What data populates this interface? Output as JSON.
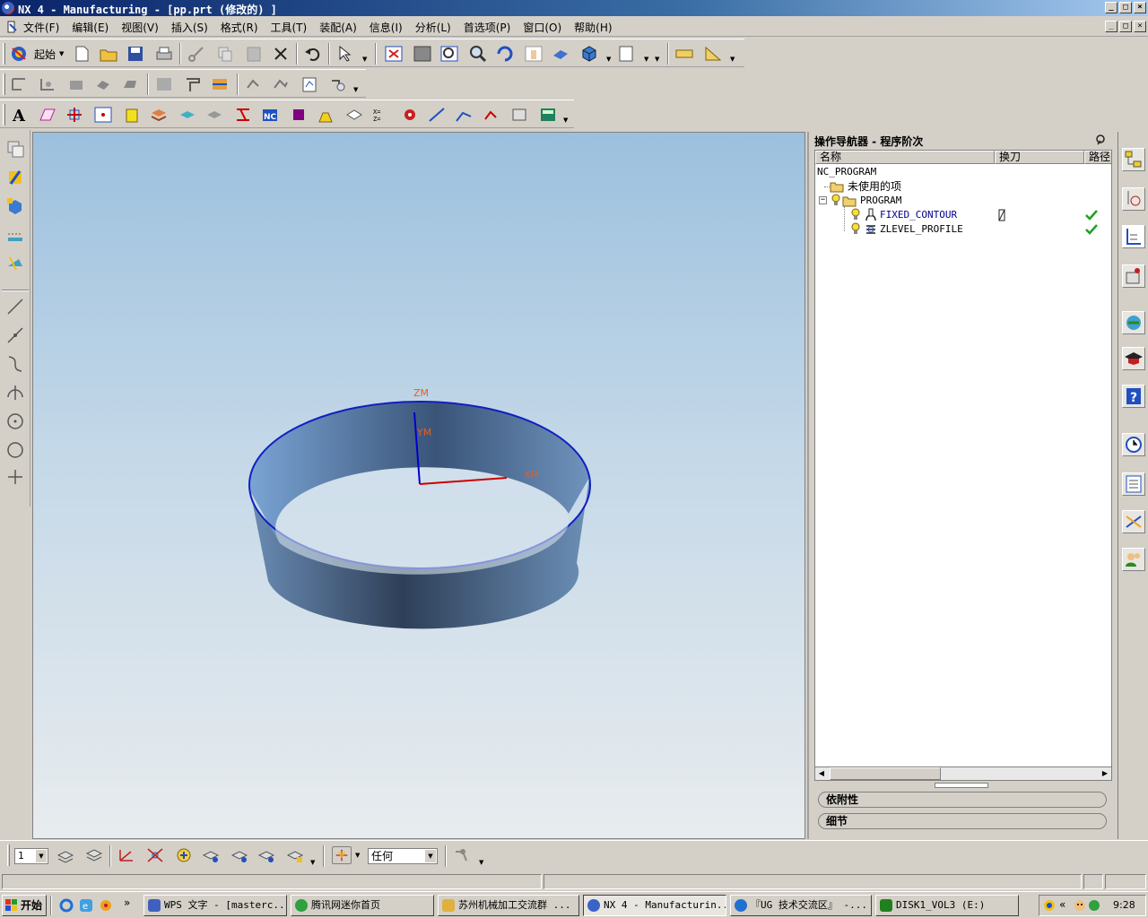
{
  "window": {
    "title": "NX 4 - Manufacturing - [pp.prt (修改的) ]",
    "controls": [
      "_",
      "□",
      "×"
    ]
  },
  "menu": {
    "items": [
      "文件(F)",
      "编辑(E)",
      "视图(V)",
      "插入(S)",
      "格式(R)",
      "工具(T)",
      "装配(A)",
      "信息(I)",
      "分析(L)",
      "首选项(P)",
      "窗口(O)",
      "帮助(H)"
    ]
  },
  "toolbar": {
    "start_label": "起始"
  },
  "viewport": {
    "axis_z": "ZM",
    "axis_y": "YM",
    "axis_x": "XM",
    "colors": {
      "z_axis": "#0000cc",
      "x_axis": "#cc0000",
      "label": "#e06020",
      "edge": "#1020c0"
    }
  },
  "navigator": {
    "title": "操作导航器 - 程序阶次",
    "columns": [
      "名称",
      "换刀",
      "路径"
    ],
    "tree": {
      "root": "NC_PROGRAM",
      "unused": "未使用的项",
      "program": "PROGRAM",
      "operations": [
        {
          "name": "FIXED_CONTOUR",
          "tool_change": true,
          "path_ok": true
        },
        {
          "name": "ZLEVEL_PROFILE",
          "tool_change": false,
          "path_ok": true
        }
      ]
    },
    "panels": [
      "依附性",
      "细节"
    ]
  },
  "bottombar": {
    "layer_value": "1",
    "filter_value": "任何"
  },
  "taskbar": {
    "start": "开始",
    "tasks": [
      {
        "label": "WPS 文字 - [masterc...",
        "active": false
      },
      {
        "label": "腾讯网迷你首页",
        "active": false
      },
      {
        "label": "苏州机械加工交流群 ...",
        "active": false
      },
      {
        "label": "NX 4 - Manufacturin...",
        "active": true
      },
      {
        "label": "『UG 技术交流区』 -...",
        "active": false
      },
      {
        "label": "DISK1_VOL3 (E:)",
        "active": false
      }
    ],
    "clock": "9:28",
    "overflow": "»",
    "tray_expand": "«"
  }
}
